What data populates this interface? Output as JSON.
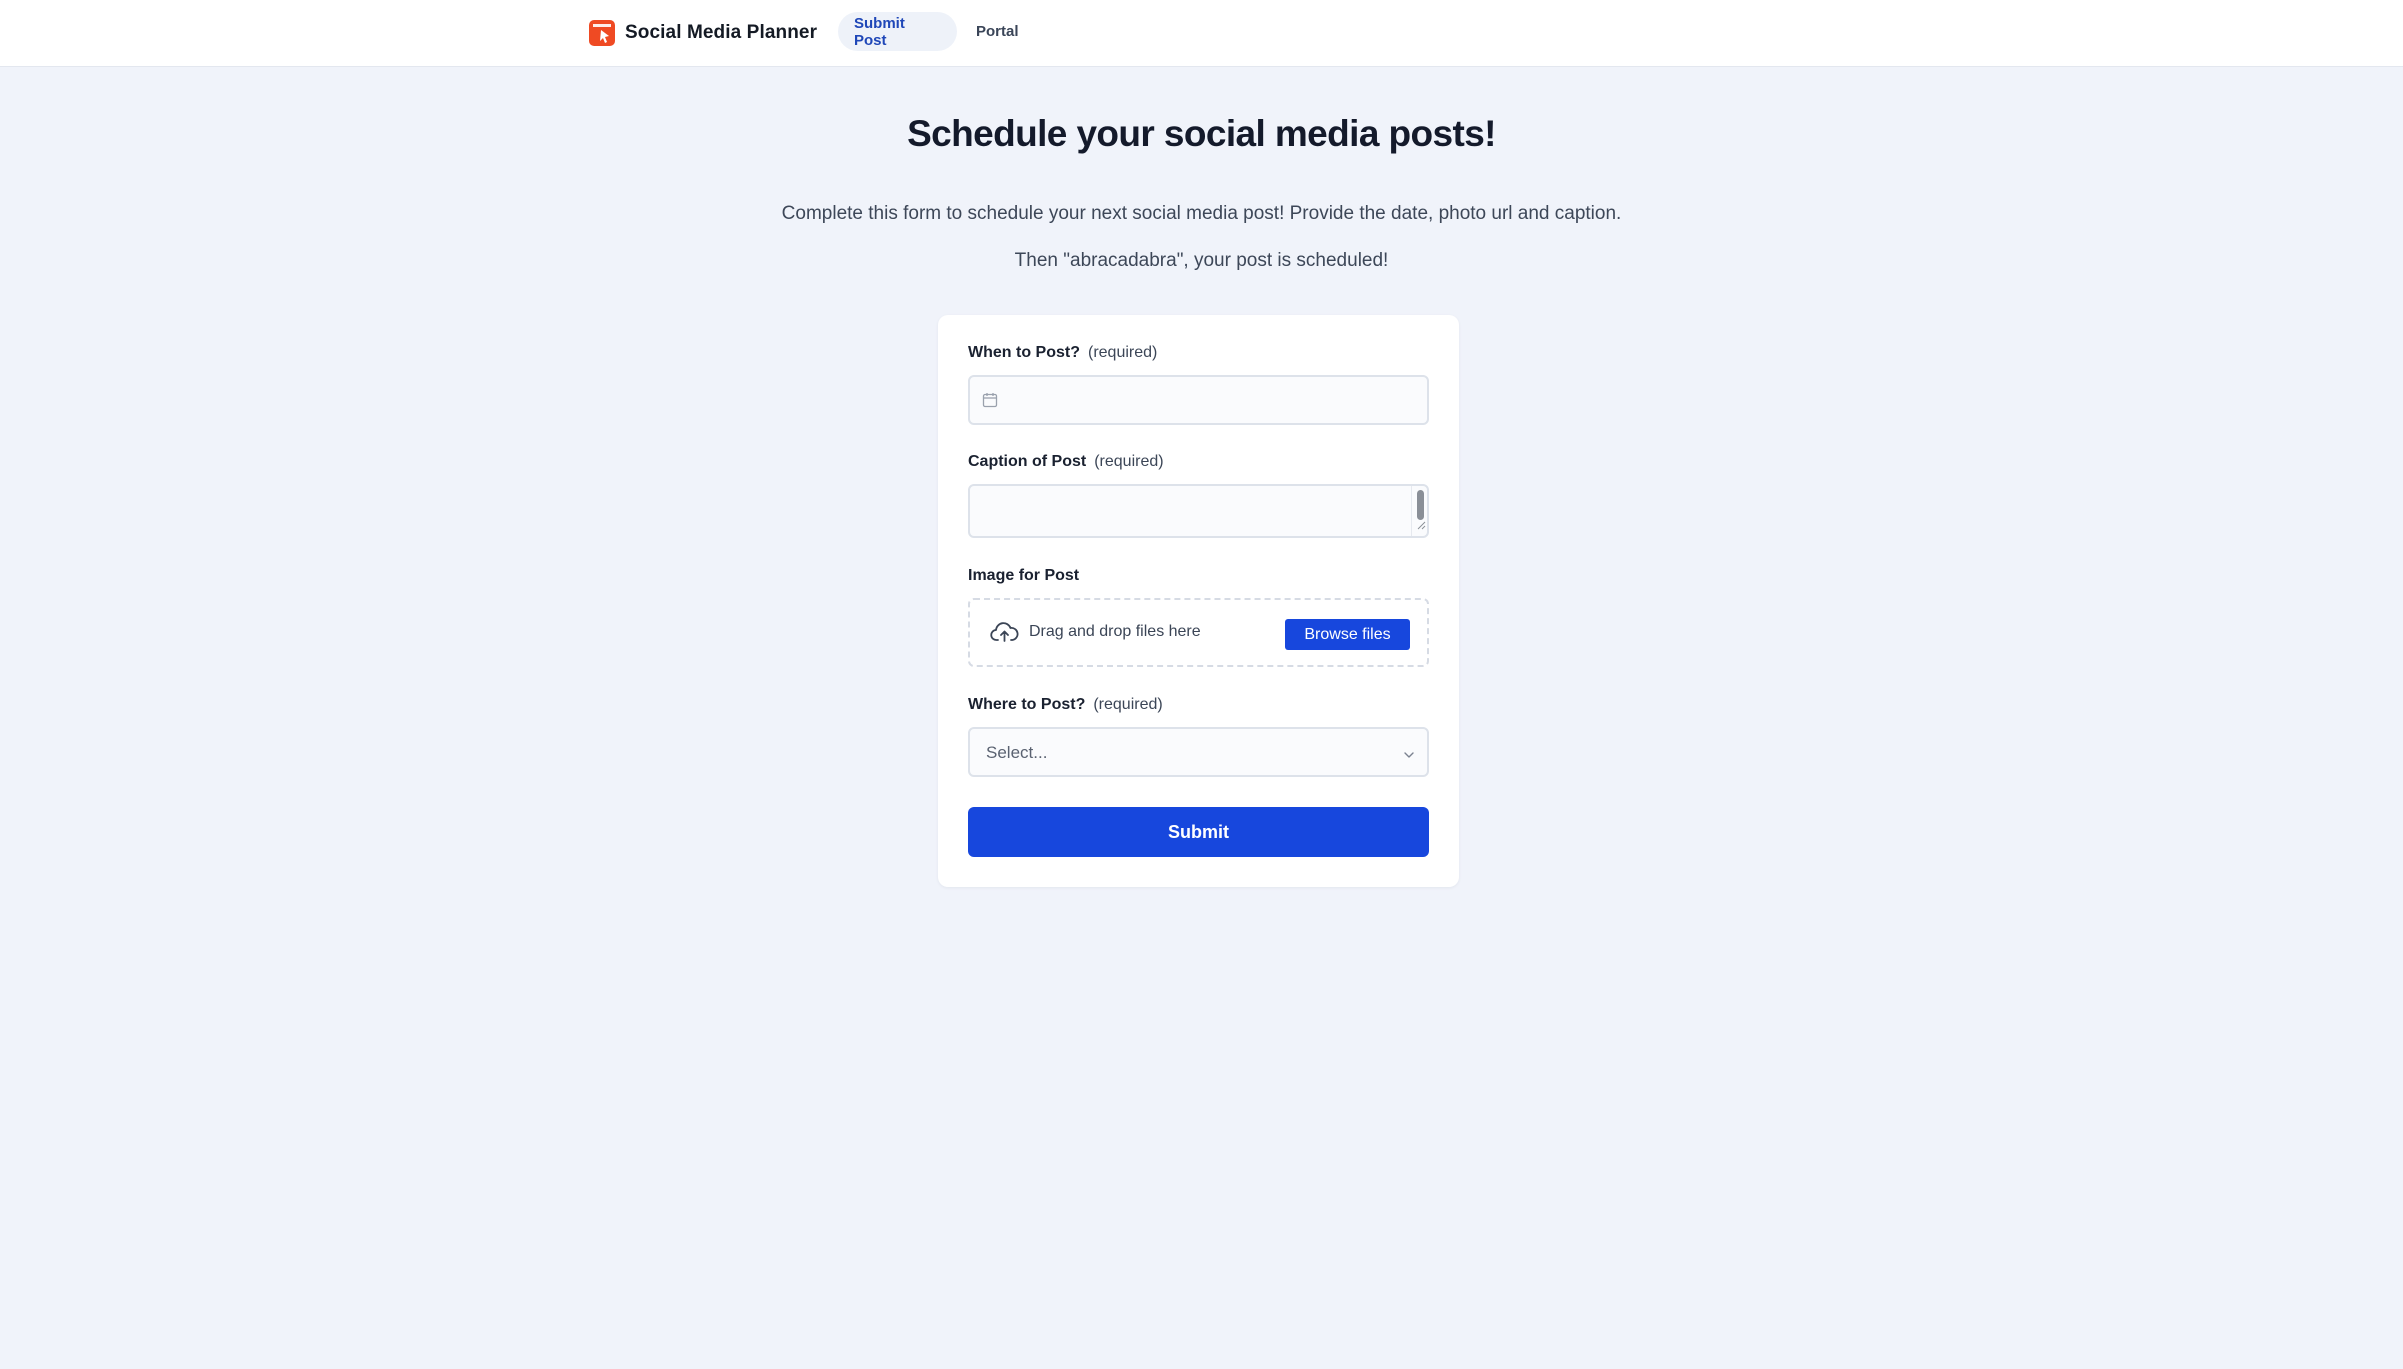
{
  "nav": {
    "brand": "Social Media Planner",
    "brand_icon": "planner-logo-icon",
    "brand_color": "#ef4a23",
    "tabs": [
      {
        "label": "Submit Post",
        "active": true
      },
      {
        "label": "Portal",
        "active": false
      }
    ]
  },
  "header": {
    "title": "Schedule your social media posts!",
    "intro_line1": "Complete this form to schedule your next social media post! Provide the date, photo url and caption.",
    "intro_line2": "Then \"abracadabra\", your post is scheduled!"
  },
  "form": {
    "when": {
      "label": "When to Post?",
      "required_note": "(required)",
      "value": "",
      "icon": "calendar-icon"
    },
    "caption": {
      "label": "Caption of Post",
      "required_note": "(required)",
      "value": ""
    },
    "image": {
      "label": "Image for Post",
      "drop_text": "Drag and drop files here",
      "browse_label": "Browse files",
      "icon": "cloud-upload-icon"
    },
    "where": {
      "label": "Where to Post?",
      "required_note": "(required)",
      "placeholder": "Select..."
    },
    "submit_label": "Submit"
  },
  "colors": {
    "accent": "#1747dd",
    "page_bg": "#f0f3fa",
    "active_tab_text": "#1f47b8"
  }
}
